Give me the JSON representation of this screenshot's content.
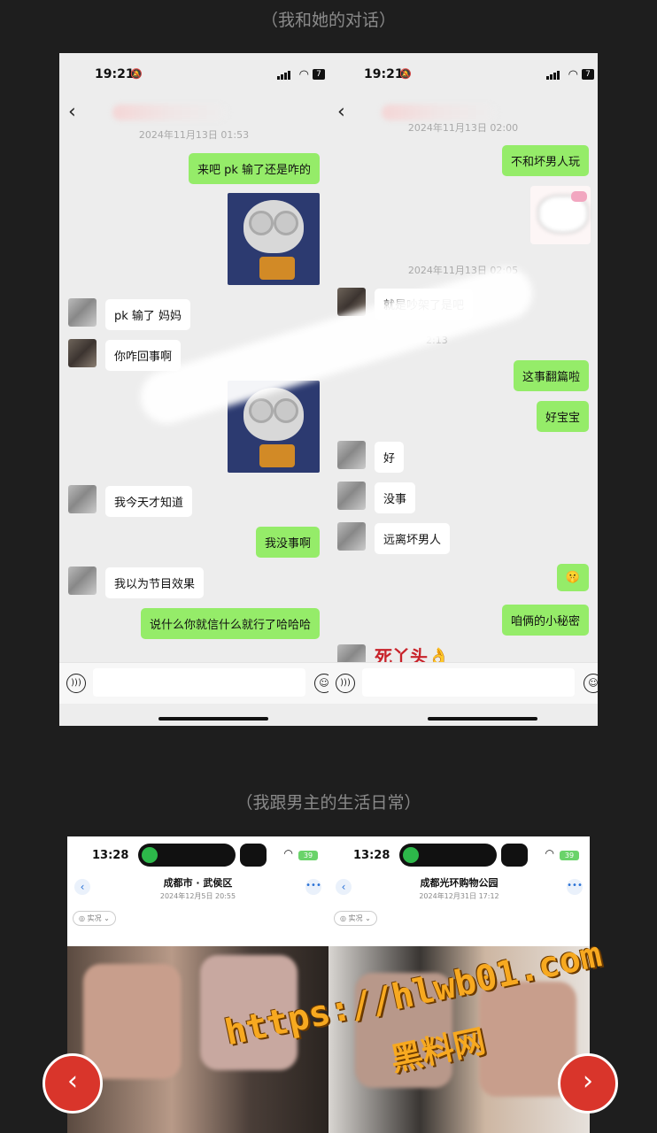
{
  "captions": {
    "top": "（我和她的对话）",
    "bottom": "（我跟男主的生活日常）"
  },
  "chat_left": {
    "time": "19:21",
    "battery": "7",
    "timestamp": "2024年11月13日 01:53",
    "messages": [
      {
        "dir": "out",
        "text": "来吧      pk 输了还是咋的"
      },
      {
        "dir": "in",
        "text": "pk 输了 妈妈"
      },
      {
        "dir": "in",
        "text": "你咋回事啊"
      },
      {
        "dir": "in",
        "text": "我今天才知道"
      },
      {
        "dir": "out",
        "text": "我没事啊"
      },
      {
        "dir": "in",
        "text": "我以为节目效果"
      },
      {
        "dir": "out",
        "text": "说什么你就信什么就行了哈哈哈"
      }
    ]
  },
  "chat_right": {
    "time": "19:21",
    "battery": "7",
    "timestamp1": "2024年11月13日 02:00",
    "timestamp2": "2024年11月13日 02:05",
    "timestamp3_partial": "2:13",
    "messages": [
      {
        "dir": "out",
        "text": "不和坏男人玩"
      },
      {
        "dir": "in",
        "text": "就是吵架了是吧"
      },
      {
        "dir": "out",
        "text": "这事翻篇啦"
      },
      {
        "dir": "out",
        "text": "好宝宝"
      },
      {
        "dir": "in",
        "text": "好"
      },
      {
        "dir": "in",
        "text": "没事"
      },
      {
        "dir": "in",
        "text": "远离坏男人"
      },
      {
        "dir": "out",
        "text": "🤫"
      },
      {
        "dir": "out",
        "text": "咱俩的小秘密"
      },
      {
        "dir": "in",
        "text": "死丫头👌"
      }
    ]
  },
  "photo_left": {
    "time": "13:28",
    "battery": "39",
    "location": "成都市 · 武侯区",
    "date": "2024年12月5日  20:55",
    "tag": "◎ 实况 ⌄"
  },
  "photo_right": {
    "time": "13:28",
    "battery": "39",
    "location": "成都光环购物公园",
    "date": "2024年12月31日  17:12",
    "tag": "◎ 实况 ⌄"
  },
  "watermark": {
    "url": "https://hlwb01.com",
    "name": "黑料网"
  },
  "nav": {
    "prev": "‹",
    "next": "›"
  },
  "colors": {
    "bubble_out": "#95ec69",
    "bubble_in": "#ffffff",
    "nav_button": "#d9352b",
    "watermark": "#f7a920"
  }
}
